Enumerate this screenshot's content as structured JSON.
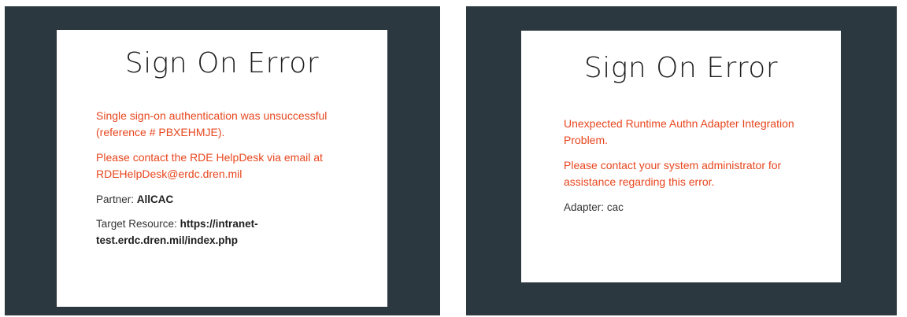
{
  "left": {
    "title": "Sign On Error",
    "message_1": "Single sign-on authentication was unsuccessful (reference # PBXEHMJE).",
    "message_2": "Please contact the RDE HelpDesk via email at RDEHelpDesk@erdc.dren.mil",
    "partner_label": "Partner:",
    "partner_value": "AllCAC",
    "target_label": "Target Resource:",
    "target_value": "https://intranet-test.erdc.dren.mil/index.php"
  },
  "right": {
    "title": "Sign On Error",
    "message_1": "Unexpected Runtime Authn Adapter Integration Problem.",
    "message_2": "Please contact your system administrator for assistance regarding this error.",
    "adapter_label": "Adapter:",
    "adapter_value": "cac"
  },
  "colors": {
    "panel_bg": "#2b3840",
    "card_bg": "#ffffff",
    "error_text": "#e8461e"
  }
}
